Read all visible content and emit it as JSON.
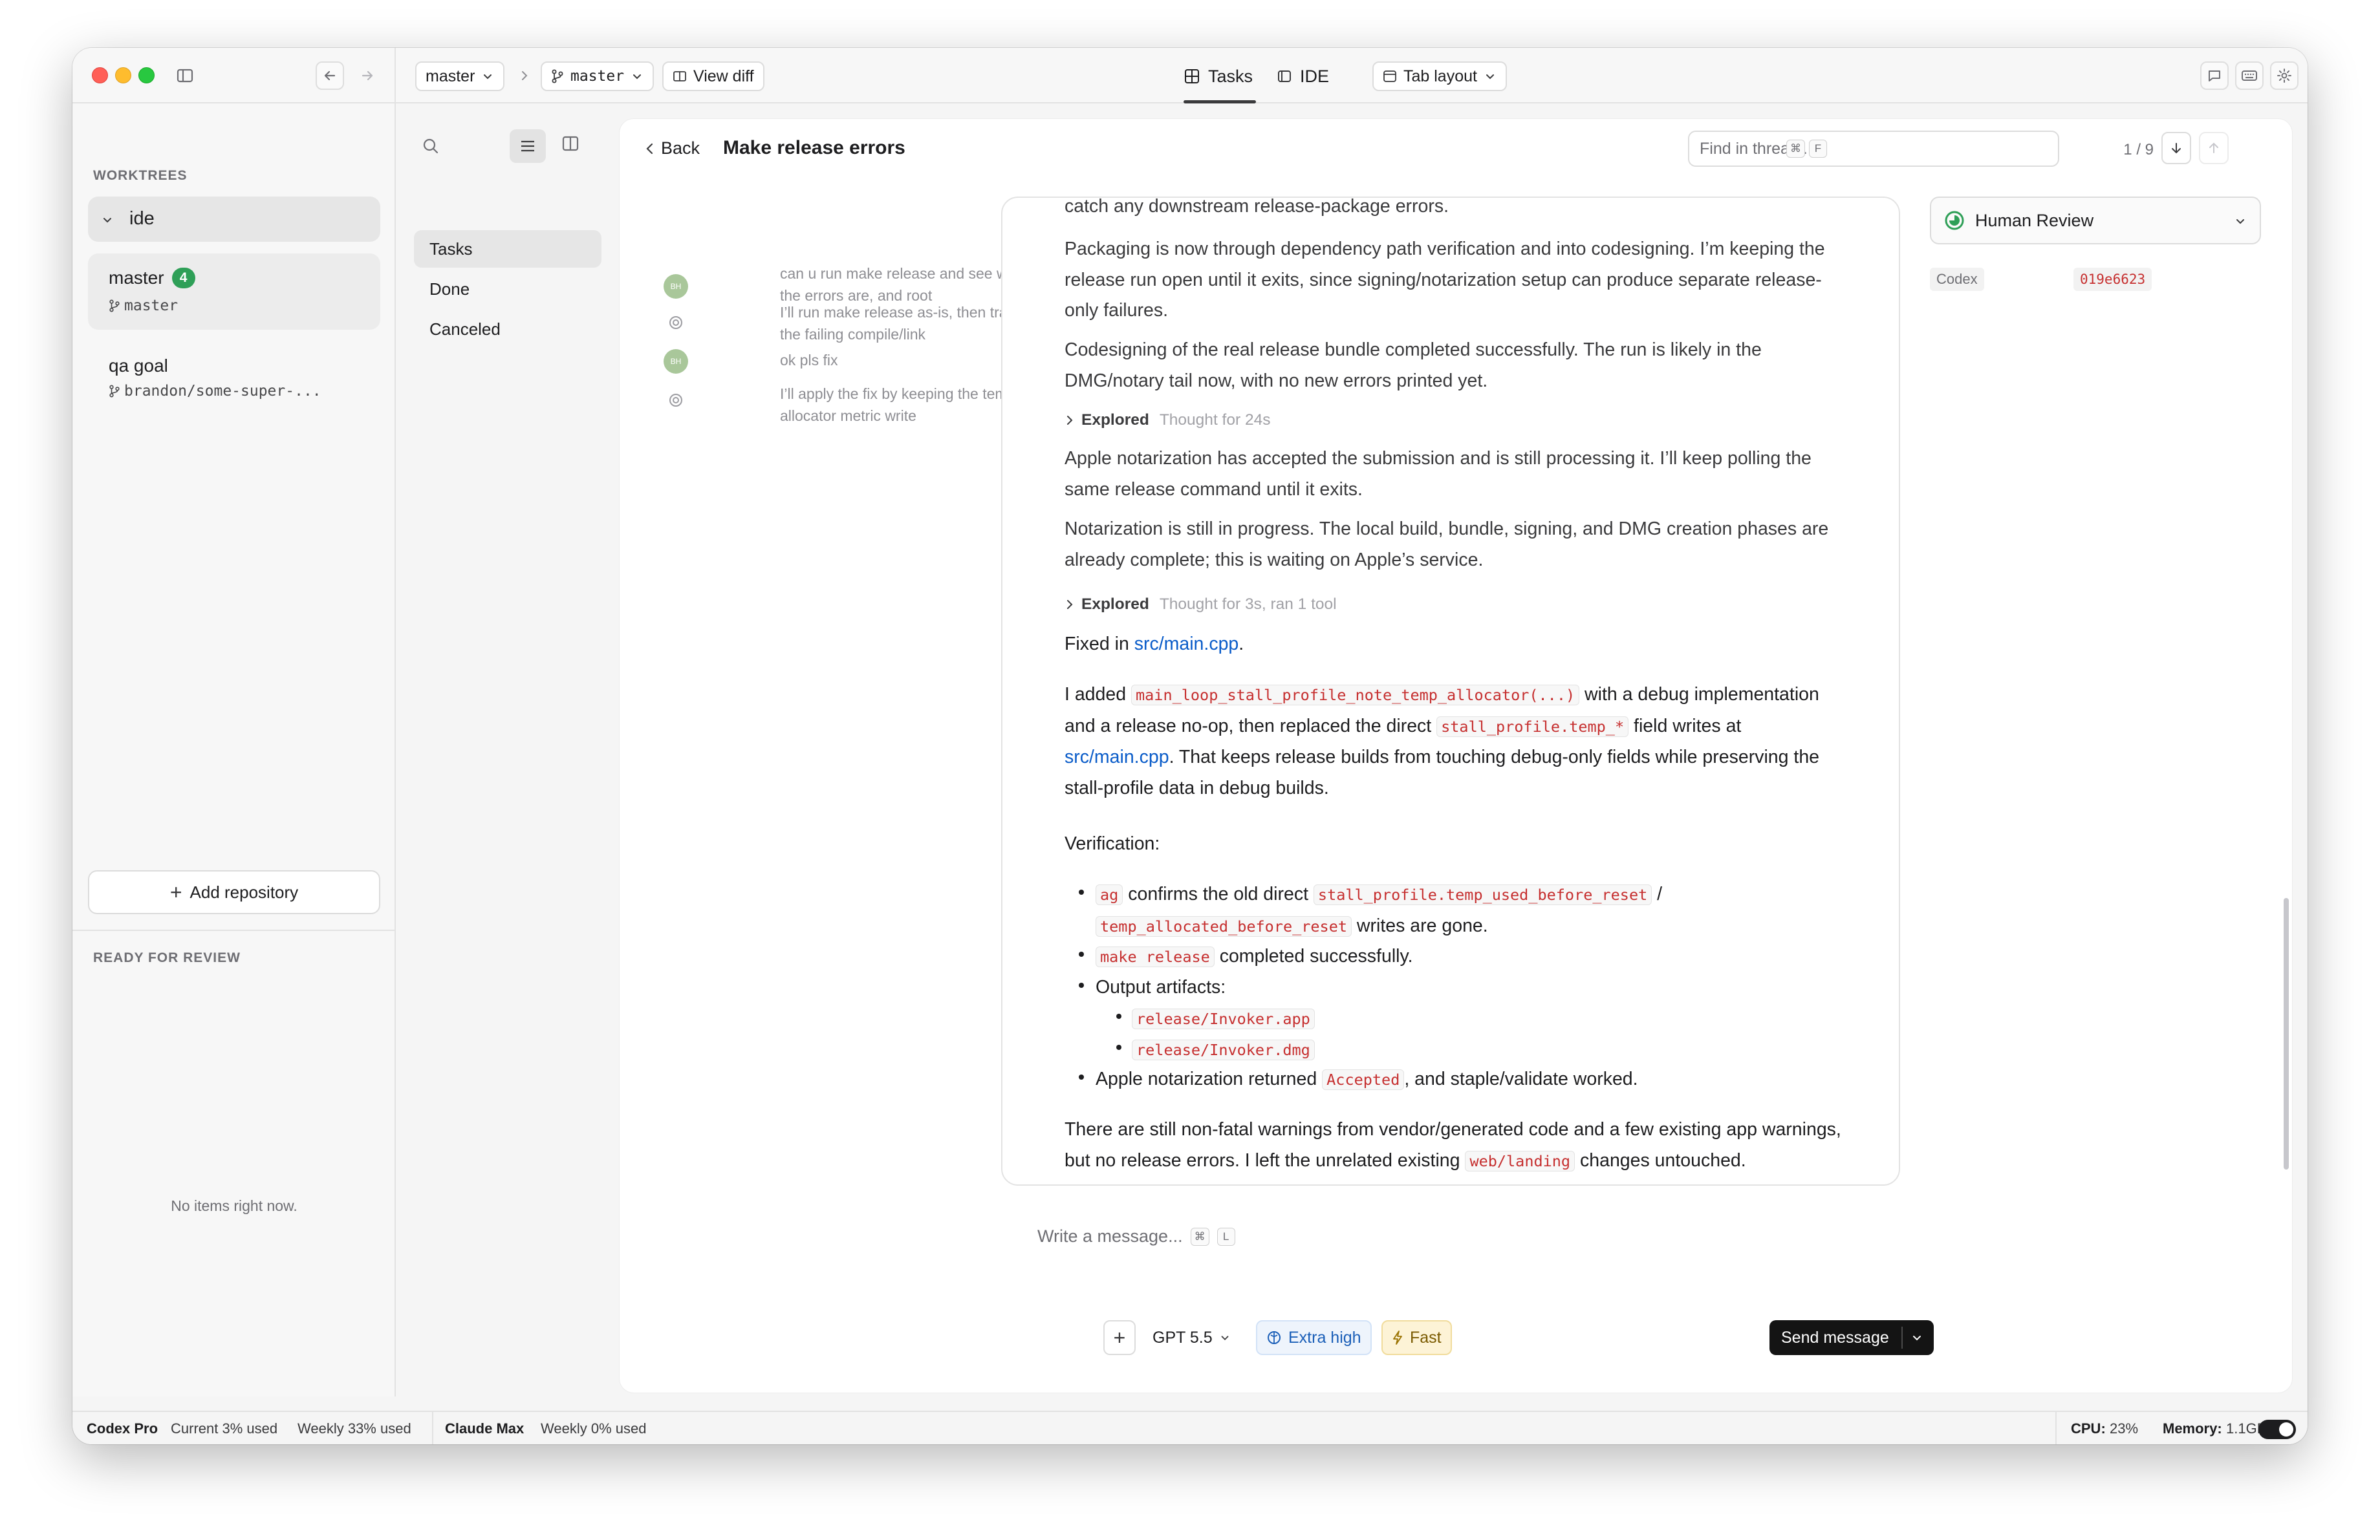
{
  "titlebar": {
    "branch_select": "master",
    "branch_pill": "master",
    "view_diff": "View diff",
    "tabs": [
      {
        "label": "Tasks",
        "active": true
      },
      {
        "label": "IDE",
        "active": false
      }
    ],
    "tab_layout": "Tab layout"
  },
  "sidebar": {
    "worktrees_header": "WORKTREES",
    "repo_name": "ide",
    "worktrees": [
      {
        "name": "master",
        "badge": "4",
        "branch": "master"
      },
      {
        "name": "qa goal",
        "branch": "brandon/some-super-..."
      }
    ],
    "add_repository": "Add repository",
    "ready_header": "READY FOR REVIEW",
    "empty_note": "No items right now."
  },
  "task_filters": [
    "Tasks",
    "Done",
    "Canceled"
  ],
  "thread_header": {
    "back": "Back",
    "title": "Make release errors",
    "find_placeholder": "Find in thread...",
    "find_kbd": [
      "⌘",
      "F"
    ],
    "pager": "1 / 9"
  },
  "mini_thread": [
    {
      "role": "user",
      "text": "can u run make release and see what the errors are, and root"
    },
    {
      "role": "assistant",
      "text": "I’ll run make release as-is, then trace the failing compile/link"
    },
    {
      "role": "user",
      "text": "ok pls fix"
    },
    {
      "role": "assistant",
      "text": "I’ll apply the fix by keeping the temp allocator metric write"
    }
  ],
  "messages": {
    "p0": "catch any downstream release-package errors.",
    "p1": "Packaging is now through dependency path verification and into codesigning. I’m keeping the release run open until it exits, since signing/notarization setup can produce separate release-only failures.",
    "p2": "Codesigning of the real release bundle completed successfully. The run is likely in the DMG/notary tail now, with no new errors printed yet.",
    "explored1": {
      "label": "Explored",
      "detail": "Thought for 24s"
    },
    "p3": "Apple notarization has accepted the submission and is still processing it. I’ll keep polling the same release command until it exits.",
    "p4": "Notarization is still in progress. The local build, bundle, signing, and DMG creation phases are already complete; this is waiting on Apple’s service.",
    "explored2": {
      "label": "Explored",
      "detail": "Thought for 3s, ran 1 tool"
    },
    "fixed_prefix": "Fixed in ",
    "fixed_link": "src/main.cpp",
    "fixed_suffix": ".",
    "added_1": "I added ",
    "added_code1": "main_loop_stall_profile_note_temp_allocator(...)",
    "added_2": " with a debug implementation and a release no-op, then replaced the direct ",
    "added_code2": "stall_profile.temp_*",
    "added_3": " field writes at ",
    "added_link": "src/main.cpp",
    "added_4": ". That keeps release builds from touching debug-only fields while preserving the stall-profile data in debug builds.",
    "verification": "Verification:",
    "b1_code": "ag",
    "b1_text": " confirms the old direct ",
    "b1_code2": "stall_profile.temp_used_before_reset",
    "b1_slash": " /",
    "b1_code3": "temp_allocated_before_reset",
    "b1_tail": " writes are gone.",
    "b2_code": "make release",
    "b2_text": " completed successfully.",
    "b3_text": "Output artifacts:",
    "b3a_code": "release/Invoker.app",
    "b3b_code": "release/Invoker.dmg",
    "b4_text": "Apple notarization returned ",
    "b4_code": "Accepted",
    "b4_tail": ", and staple/validate worked.",
    "p_last_1": "There are still non-fatal warnings from vendor/generated code and a few existing app warnings, but no release errors. I left the unrelated existing ",
    "p_last_code": "web/landing",
    "p_last_2": " changes untouched."
  },
  "review_panel": {
    "status": "Human Review",
    "tag_label": "Codex",
    "tag_value": "019e6623"
  },
  "composer": {
    "placeholder": "Write a message...",
    "kbd": [
      "⌘",
      "L"
    ],
    "model": "GPT 5.5",
    "reasoning": "Extra high",
    "speed": "Fast",
    "send": "Send message"
  },
  "statusbar": {
    "codex_plan": "Codex Pro",
    "codex_current": "Current 3% used",
    "codex_weekly": "Weekly 33% used",
    "claude_plan": "Claude Max",
    "claude_weekly": "Weekly 0% used",
    "cpu_label": "CPU:",
    "cpu_value": "23%",
    "mem_label": "Memory:",
    "mem_value": "1.1GB"
  },
  "colors": {
    "accent_link": "#0a5cc9",
    "code_text": "#c62f2f",
    "badge_green": "#2e9f57",
    "send_bg": "#141414",
    "reasoning_blue": "#1b5fb8",
    "fast_bg": "#fdf3d6"
  }
}
